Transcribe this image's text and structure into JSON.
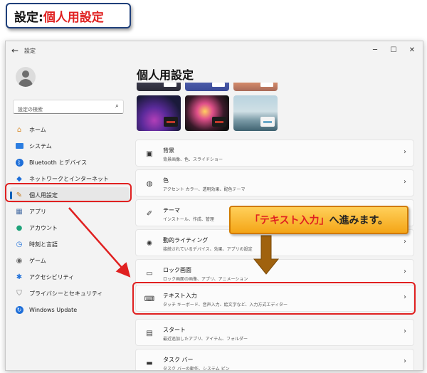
{
  "label": {
    "prefix": "設定:",
    "highlight": "個人用設定"
  },
  "window": {
    "title": "設定",
    "back": "←",
    "minimize": "─",
    "maximize": "☐",
    "close": "✕"
  },
  "search": {
    "placeholder": "設定の検索"
  },
  "sidebar": {
    "items": [
      {
        "label": "ホーム"
      },
      {
        "label": "システム"
      },
      {
        "label": "Bluetooth とデバイス"
      },
      {
        "label": "ネットワークとインターネット"
      },
      {
        "label": "個人用設定"
      },
      {
        "label": "アプリ"
      },
      {
        "label": "アカウント"
      },
      {
        "label": "時刻と言語"
      },
      {
        "label": "ゲーム"
      },
      {
        "label": "アクセシビリティ"
      },
      {
        "label": "プライバシーとセキュリティ"
      },
      {
        "label": "Windows Update"
      }
    ],
    "active_index": 4
  },
  "main": {
    "title": "個人用設定",
    "cards": [
      {
        "title": "背景",
        "desc": "背景画像、色、スライドショー"
      },
      {
        "title": "色",
        "desc": "アクセント カラー、透明効果、配色テーマ"
      },
      {
        "title": "テーマ",
        "desc": "インストール、作成、管理"
      },
      {
        "title": "動的ライティング",
        "desc": "接続されているデバイス、効果、アプリの設定"
      },
      {
        "title": "ロック画面",
        "desc": "ロック画面の画像、アプリ、アニメーション"
      },
      {
        "title": "テキスト入力",
        "desc": "タッチ キーボード、音声入力、絵文字など、入力方式エディター"
      },
      {
        "title": "スタート",
        "desc": "最近追加したアプリ、アイテム、フォルダー"
      },
      {
        "title": "タスク バー",
        "desc": "タスク バーの動作、システム ピン"
      }
    ]
  },
  "callout": {
    "highlight": "「テキスト入力」",
    "rest": "へ進みます。"
  },
  "colors": {
    "accent": "#005fb8",
    "annotation_red": "#e02020",
    "callout_orange": "#f4a517"
  }
}
